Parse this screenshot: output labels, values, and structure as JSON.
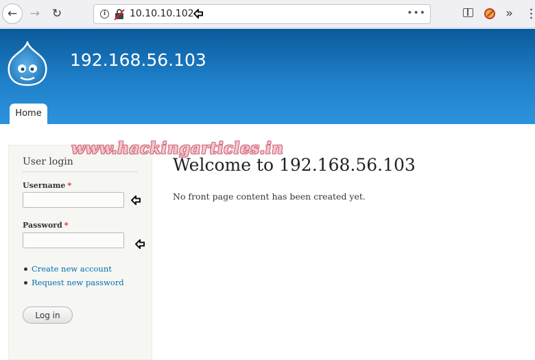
{
  "browser": {
    "url": "10.10.10.102",
    "back_glyph": "←",
    "forward_glyph": "→",
    "reload_glyph": "↻",
    "info_glyph": "i",
    "page_actions_glyph": "•••",
    "overflow_glyph": "»"
  },
  "site": {
    "name": "192.168.56.103",
    "header_colors": [
      "#0a5a9b",
      "#2d93dd"
    ],
    "nav": {
      "home_tab": "Home"
    }
  },
  "login_block": {
    "title": "User login",
    "username_label": "Username",
    "password_label": "Password",
    "required_marker": "*",
    "username_value": "",
    "password_value": "",
    "links": [
      "Create new account",
      "Request new password"
    ],
    "submit_label": "Log in"
  },
  "main": {
    "title": "Welcome to 192.168.56.103",
    "body": "No front page content has been created yet."
  },
  "watermark": {
    "text": "www.hackingarticles.in"
  },
  "colors": {
    "link": "#0070b3",
    "required": "#e02222"
  }
}
